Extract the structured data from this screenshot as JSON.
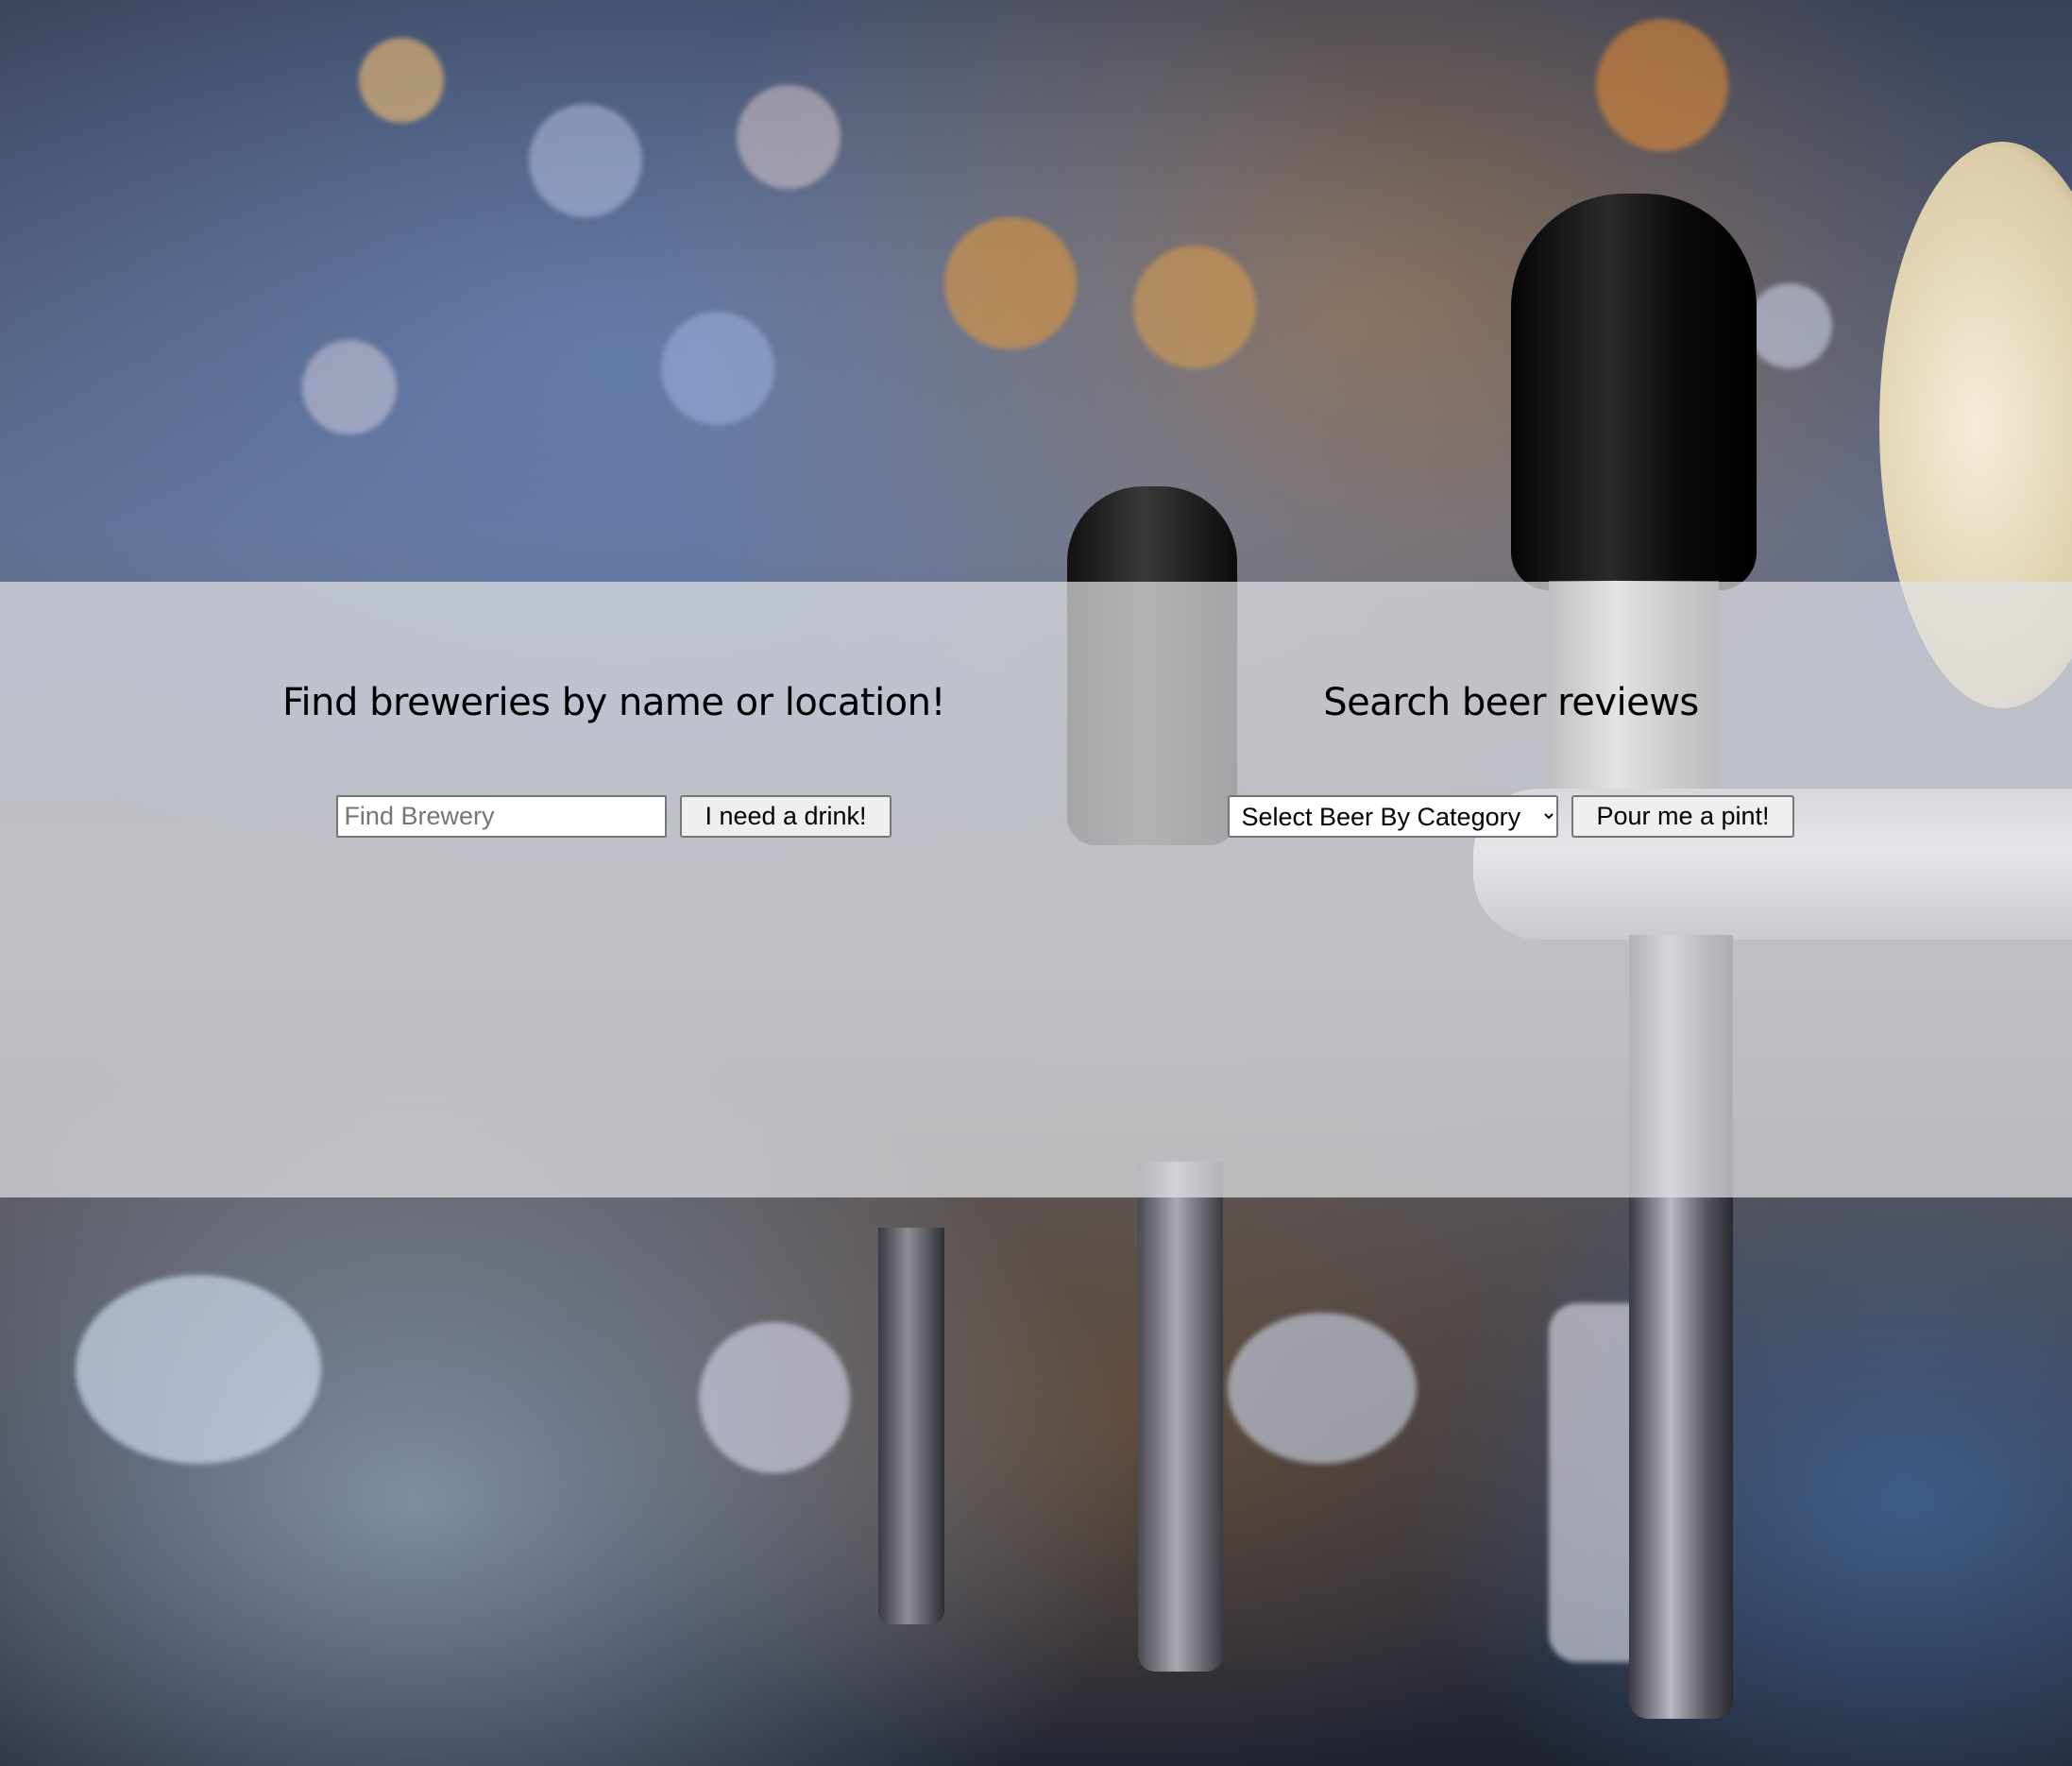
{
  "brewery_search": {
    "heading": "Find breweries by name or location!",
    "input_placeholder": "Find Brewery",
    "input_value": "",
    "button_label": "I need a drink!"
  },
  "beer_search": {
    "heading": "Search beer reviews",
    "select_selected": "Select Beer By Category",
    "button_label": "Pour me a pint!"
  }
}
